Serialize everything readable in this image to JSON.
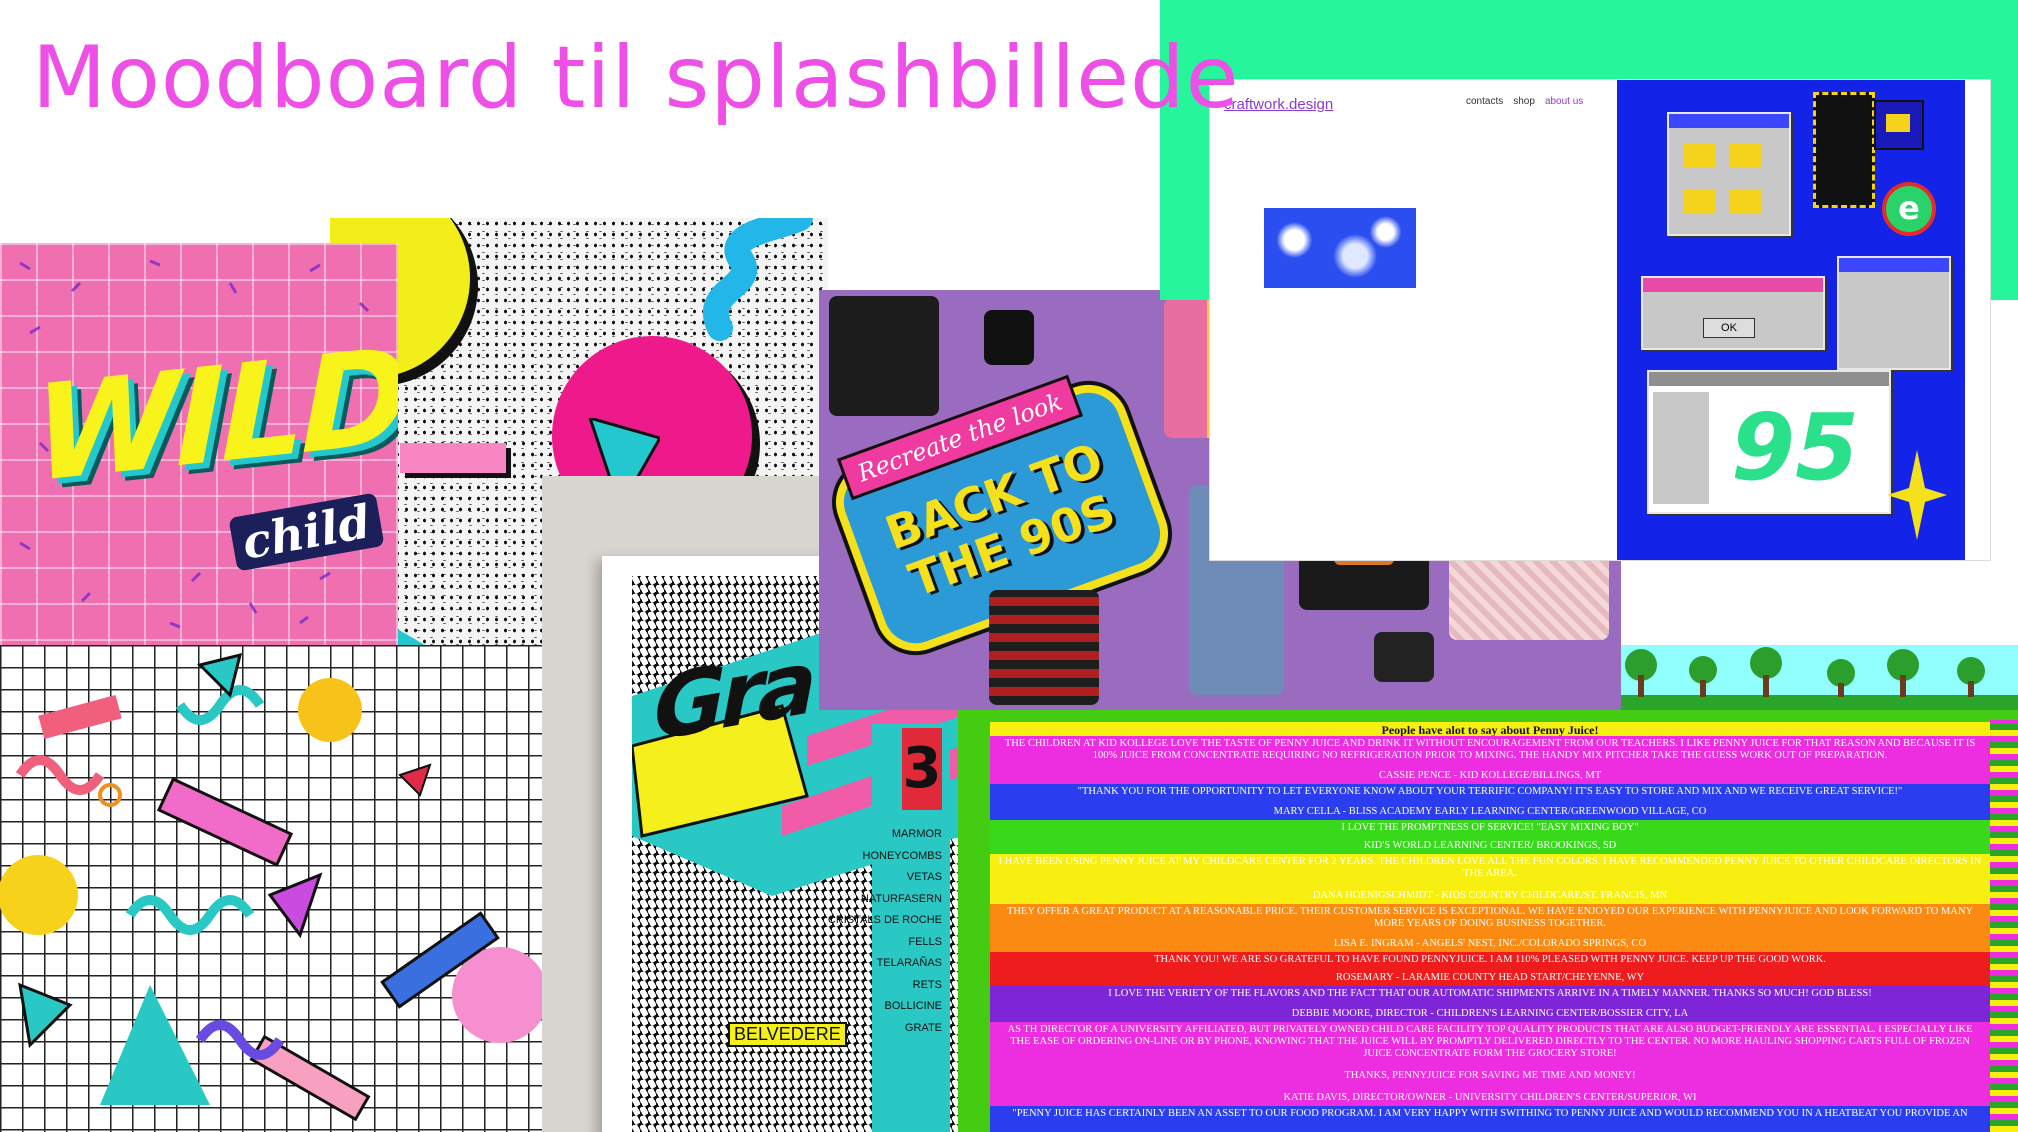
{
  "slide": {
    "title": "Moodboard til splashbillede"
  },
  "wild_child": {
    "word1": "WILD",
    "word2": "child"
  },
  "magazine": {
    "number": "3",
    "masthead": "Gra",
    "items": [
      "MARMOR",
      "HONEYCOMBS",
      "VETAS",
      "NATURFASERN",
      "CRISTALS DE ROCHE",
      "FELLS",
      "TELARAÑAS",
      "RETS",
      "BOLLICINE",
      "GRATE"
    ],
    "brand": "BELVEDERE"
  },
  "clothes": {
    "tagline": "Recreate the look",
    "headline_1": "BACK TO",
    "headline_2": "THE 90S"
  },
  "craftwork": {
    "logo": "craftwork.design",
    "nav": [
      "contacts",
      "shop",
      "about us"
    ],
    "dialog_button": "OK",
    "big_number": "95"
  },
  "penny_juice": {
    "heading": "People have alot to say about Penny Juice!",
    "testimonials": [
      {
        "text": "THE CHILDREN AT KID KOLLEGE LOVE THE TASTE OF PENNY JUICE AND DRINK IT WITHOUT ENCOURAGEMENT FROM OUR TEACHERS. I LIKE PENNY JUICE FOR THAT REASON AND BECAUSE IT IS 100% JUICE FROM CONCENTRATE REQUIRING NO REFRIGERATION PRIOR TO MIXING. THE HANDY MIX PITCHER TAKE THE GUESS WORK OUT OF PREPARATION.",
        "author": "CASSIE PENCE - KID KOLLEGE/BILLINGS, MT",
        "color": "#ec2de0"
      },
      {
        "text": "\"THANK YOU FOR THE OPPORTUNITY TO LET EVERYONE KNOW ABOUT YOUR TERRIFIC COMPANY! IT'S EASY TO STORE AND MIX AND WE RECEIVE GREAT SERVICE!\"",
        "author": "MARY CELLA - BLISS ACADEMY EARLY LEARNING CENTER/GREENWOOD VILLAGE, CO",
        "color": "#2a3ef0"
      },
      {
        "text": "I LOVE THE PROMPTNESS OF SERVICE! \"EASY MIXING BOY\"",
        "author": "KID'S WORLD LEARNING CENTER/ BROOKINGS, SD",
        "color": "#38d81a"
      },
      {
        "text": "I HAVE BEEN USING PENNY JUICE AT MY CHILDCARE CENTER FOR 2 YEARS. THE CHILDREN LOVE ALL THE FUN COLORS. I HAVE RECOMMENDED PENNY JUICE TO OTHER CHILDCARE DIRECTORS IN THE AREA.",
        "author": "DANA HOENIGSCHMIDT - KIDS COUNTRY CHILDCARE/ST. FRANCIS, MN",
        "color": "#f7ef10"
      },
      {
        "text": "THEY OFFER A GREAT PRODUCT AT A REASONABLE PRICE. THEIR CUSTOMER SERVICE IS EXCEPTIONAL. WE HAVE ENJOYED OUR EXPERIENCE WITH PENNYJUICE AND LOOK FORWARD TO MANY MORE YEARS OF DOING BUSINESS TOGETHER.",
        "author": "LISA E. INGRAM - ANGELS' NEST, INC./COLORADO SPRINGS, CO",
        "color": "#fb8a12"
      },
      {
        "text": "THANK YOU! WE ARE SO GRATEFUL TO HAVE FOUND PENNYJUICE. I AM 110% PLEASED WITH PENNY JUICE. KEEP UP THE GOOD WORK.",
        "author": "ROSEMARY - LARAMIE COUNTY HEAD START/CHEYENNE, WY",
        "color": "#ee1c1c"
      },
      {
        "text": "I LOVE THE VERIETY OF THE FLAVORS AND THE FACT THAT OUR AUTOMATIC SHIPMENTS ARRIVE IN A TIMELY MANNER. THANKS SO MUCH! GOD BLESS!",
        "author": "DEBBIE MOORE, DIRECTOR - CHILDREN'S LEARNING CENTER/BOSSIER CITY, LA",
        "color": "#7e25d8"
      },
      {
        "text": "AS TH DIRECTOR OF A UNIVERSITY AFFILIATED, BUT PRIVATELY OWNED CHILD CARE FACILITY TOP QUALITY PRODUCTS THAT ARE ALSO BUDGET-FRIENDLY ARE ESSENTIAL. I ESPECIALLY LIKE THE EASE OF ORDERING ON-LINE OR BY PHONE, KNOWING THAT THE JUICE WILL BY PROMPTLY DELIVERED DIRECTLY TO THE CENTER. NO MORE HAULING SHOPPING CARTS FULL OF FROZEN JUICE CONCENTRATE FORM THE GROCERY STORE!",
        "author": "THANKS, PENNYJUICE FOR SAVING ME TIME AND MONEY!",
        "color": "#ec2de0"
      },
      {
        "text": "",
        "author": "KATIE DAVIS, DIRECTOR/OWNER - UNIVERSITY CHILDREN'S CENTER/SUPERIOR, WI",
        "color": "#ec2de0"
      },
      {
        "text": "\"PENNY JUICE HAS CERTAINLY BEEN AN ASSET TO OUR FOOD PROGRAM. I AM VERY HAPPY WITH SWITHING TO PENNY JUICE AND WOULD RECOMMEND YOU IN A HEATBEAT YOU PROVIDE AN",
        "author": "",
        "color": "#2a3ef0"
      }
    ]
  },
  "colors": {
    "title": "#ee4fe6",
    "mint": "#27f59c",
    "hot_pink": "#ec2de0",
    "teal": "#2ac8c4",
    "yellow": "#f7ef10"
  }
}
